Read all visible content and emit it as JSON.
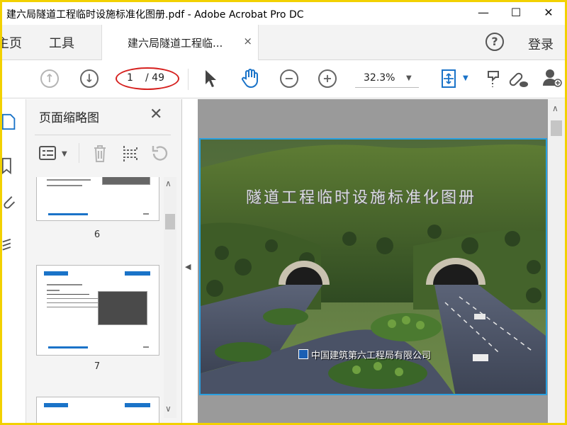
{
  "window": {
    "title": "建六局隧道工程临时设施标准化图册.pdf - Adobe Acrobat Pro DC",
    "watermark": "",
    "minimize": "—",
    "maximize": "☐",
    "close": "✕"
  },
  "menu": {
    "home_tab": "主页",
    "tools_tab": "工具",
    "doc_tab": "建六局隧道工程临...",
    "doc_tab_close": "×",
    "help": "?",
    "login": "登录"
  },
  "toolbar": {
    "prev_page": "↑",
    "next_page": "↓",
    "page_current": "1",
    "page_total": "/ 49",
    "zoom_out": "−",
    "zoom_in": "+",
    "zoom_level": "32.3%",
    "icons": [
      "prev-page-icon",
      "next-page-icon",
      "select-cursor-icon",
      "hand-tool-icon",
      "zoom-out-icon",
      "zoom-in-icon",
      "fit-page-icon",
      "comment-icon",
      "share-link-icon",
      "add-user-icon"
    ]
  },
  "thumbnail_panel": {
    "title": "页面缩略图",
    "close": "✕",
    "thumbnails": [
      {
        "page_label": "6"
      },
      {
        "page_label": "7"
      }
    ]
  },
  "document": {
    "heading": "隧道工程临时设施标准化图册",
    "company": "中国建筑第六工程局有限公司"
  },
  "colors": {
    "highlight_border": "#f2d100",
    "annotation_oval": "#d6211f",
    "thumb_band": "#1a73c8",
    "page_border": "#2aa0e0"
  }
}
